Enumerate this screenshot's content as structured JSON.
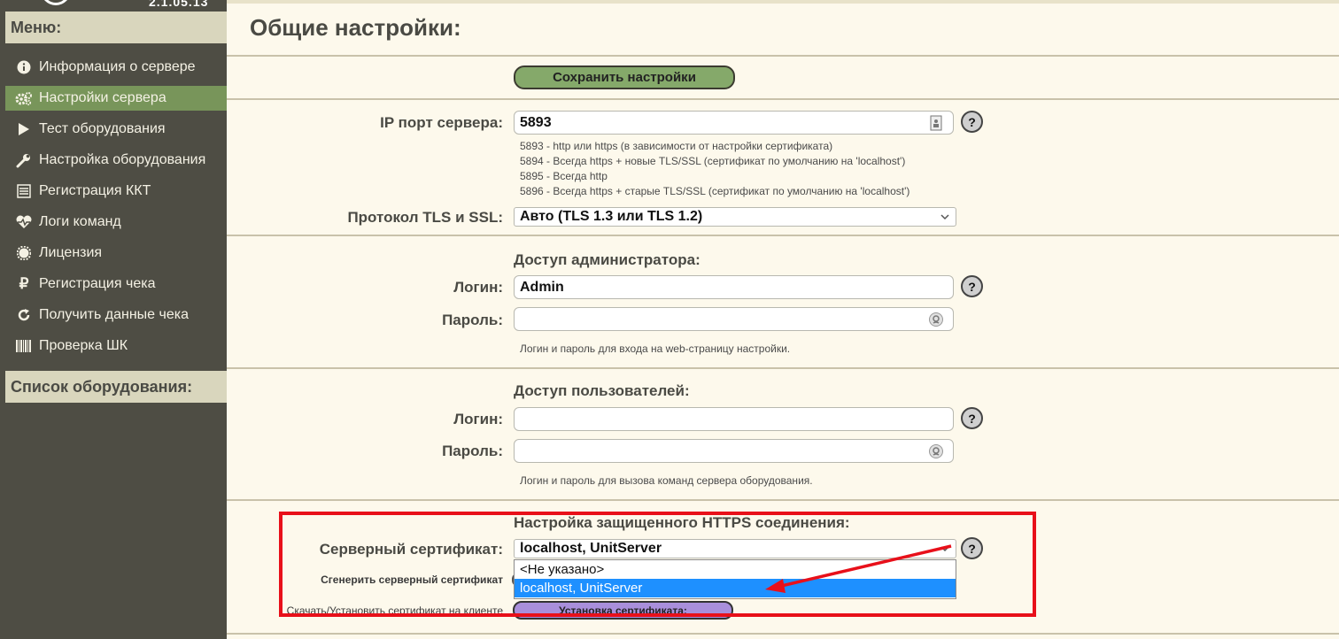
{
  "logo_text": "2.1.05.13",
  "sidebar": {
    "menu_title": "Меню:",
    "items": [
      {
        "label": "Информация о сервере",
        "icon": "info-icon"
      },
      {
        "label": "Настройки сервера",
        "icon": "gears-icon"
      },
      {
        "label": "Тест оборудования",
        "icon": "play-icon"
      },
      {
        "label": "Настройка оборудования",
        "icon": "wrench-icon"
      },
      {
        "label": "Регистрация ККТ",
        "icon": "list-icon"
      },
      {
        "label": "Логи команд",
        "icon": "heartbeat-icon"
      },
      {
        "label": "Лицензия",
        "icon": "certificate-icon"
      },
      {
        "label": "Регистрация чека",
        "icon": "ruble-icon"
      },
      {
        "label": "Получить данные чека",
        "icon": "refresh-icon"
      },
      {
        "label": "Проверка ШК",
        "icon": "barcode-icon"
      }
    ],
    "active_index": 1,
    "equipment_title": "Список оборудования:"
  },
  "main": {
    "title": "Общие настройки:",
    "save_label": "Сохранить настройки",
    "ip_port": {
      "label": "IP порт сервера:",
      "value": "5893",
      "hints": [
        "5893 - http или https (в зависимости от настройки сертификата)",
        "5894 - Всегда https + новые TLS/SSL (сертификат по умолчанию на 'localhost')",
        "5895 - Всегда http",
        "5896 - Всегда https + старые TLS/SSL (сертификат по умолчанию на 'localhost')"
      ]
    },
    "tls": {
      "label": "Протокол TLS и SSL:",
      "value": "Авто (TLS 1.3 или TLS 1.2)"
    },
    "admin": {
      "title": "Доступ администратора:",
      "login_label": "Логин:",
      "login_value": "Admin",
      "password_label": "Пароль:",
      "password_value": "",
      "hint": "Логин и пароль для входа на web-страницу настройки."
    },
    "users": {
      "title": "Доступ пользователей:",
      "login_label": "Логин:",
      "login_value": "",
      "password_label": "Пароль:",
      "password_value": "",
      "hint": "Логин и пароль для вызова команд сервера оборудования."
    },
    "https": {
      "title": "Настройка защищенного HTTPS соединения:",
      "cert_label": "Серверный сертификат:",
      "cert_value": "localhost, UnitServer",
      "options": [
        "<Не указано>",
        "localhost, UnitServer"
      ],
      "selected_option": 1,
      "generate_label": "Сгенерить серверный сертификат",
      "download_label": "Скачать/Установить сертификат на клиенте",
      "install_label": "Установка сертификата:"
    },
    "help_label": "?"
  },
  "colors": {
    "sidebar_bg": "#4e4d44",
    "active_item": "#78955a",
    "page_bg": "#fdf9ec",
    "save_button": "#85a96a",
    "install_button": "#a98fdb",
    "annotation_red": "#e8101a",
    "dropdown_selected": "#1e90ff"
  }
}
